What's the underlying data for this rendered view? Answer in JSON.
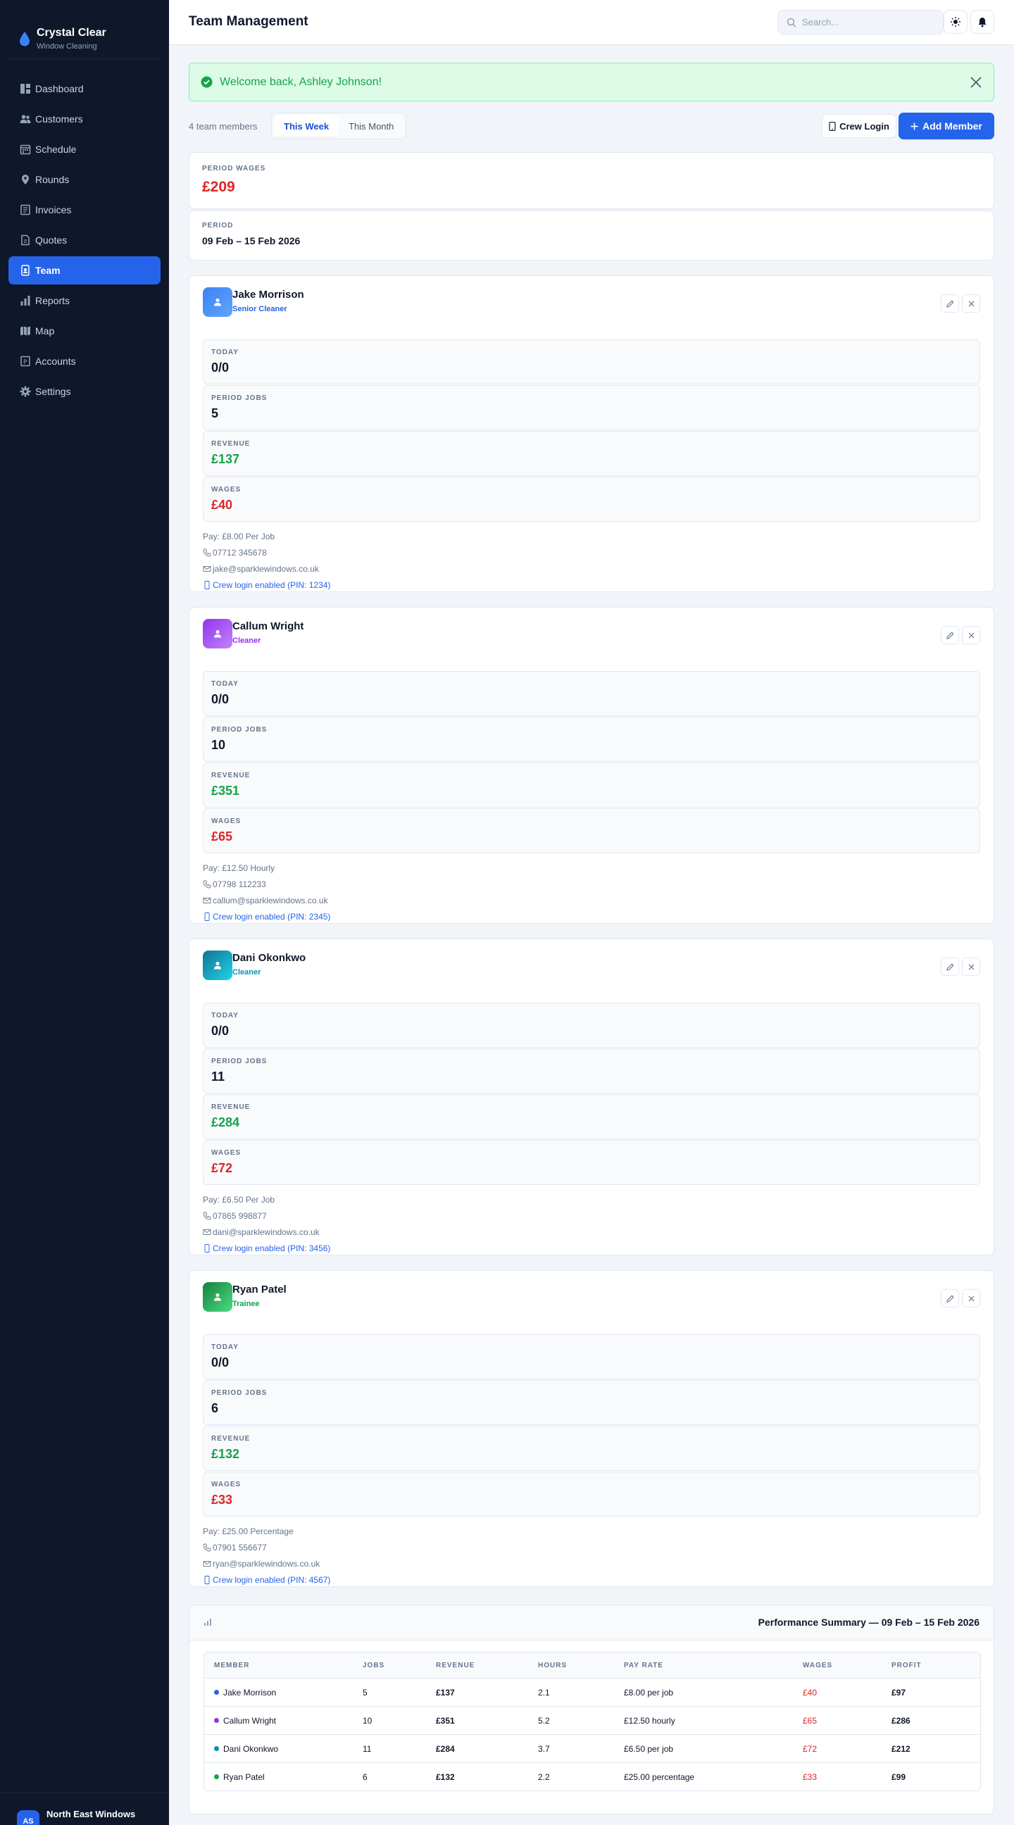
{
  "brand": {
    "name": "Crystal Clear",
    "subtitle": "Window Cleaning"
  },
  "nav": [
    {
      "label": "Dashboard",
      "icon": "dashboard-icon"
    },
    {
      "label": "Customers",
      "icon": "users-icon"
    },
    {
      "label": "Schedule",
      "icon": "calendar-icon"
    },
    {
      "label": "Rounds",
      "icon": "map-pin-icon"
    },
    {
      "label": "Invoices",
      "icon": "invoice-icon"
    },
    {
      "label": "Quotes",
      "icon": "quote-icon"
    },
    {
      "label": "Team",
      "icon": "id-badge-icon",
      "active": true
    },
    {
      "label": "Reports",
      "icon": "bar-chart-icon"
    },
    {
      "label": "Map",
      "icon": "map-icon"
    },
    {
      "label": "Accounts",
      "icon": "ledger-icon"
    },
    {
      "label": "Settings",
      "icon": "gear-icon"
    }
  ],
  "footer": {
    "initials": "AS",
    "business": "North East Windows"
  },
  "header": {
    "title": "Team Management",
    "search_placeholder": "Search..."
  },
  "alert": {
    "message": "Welcome back, Ashley Johnson!"
  },
  "toolbar": {
    "members_count": "4 team members",
    "period_tabs": [
      {
        "label": "This Week",
        "active": true
      },
      {
        "label": "This Month"
      }
    ],
    "crew_login_label": "Crew Login",
    "add_member_label": "Add Member"
  },
  "summary_cards": {
    "wages_label": "PERIOD WAGES",
    "wages_value": "£209",
    "period_label": "PERIOD",
    "period_value": "09 Feb – 15 Feb 2026"
  },
  "stat_labels": {
    "today": "TODAY",
    "jobs": "PERIOD JOBS",
    "revenue": "REVENUE",
    "wages": "WAGES"
  },
  "members": [
    {
      "name": "Jake Morrison",
      "role": "Senior Cleaner",
      "role_color": "#2563eb",
      "avatar_gradient": [
        "#3b82f6",
        "#60a5fa"
      ],
      "today": "0/0",
      "jobs": "5",
      "revenue": "£137",
      "wages": "£40",
      "pay": "Pay: £8.00 Per Job",
      "phone": "07712 345678",
      "email": "jake@sparklewindows.co.uk",
      "crew": "Crew login enabled (PIN: 1234)"
    },
    {
      "name": "Callum Wright",
      "role": "Cleaner",
      "role_color": "#9333ea",
      "avatar_gradient": [
        "#9333ea",
        "#c084fc"
      ],
      "today": "0/0",
      "jobs": "10",
      "revenue": "£351",
      "wages": "£65",
      "pay": "Pay: £12.50 Hourly",
      "phone": "07798 112233",
      "email": "callum@sparklewindows.co.uk",
      "crew": "Crew login enabled (PIN: 2345)"
    },
    {
      "name": "Dani Okonkwo",
      "role": "Cleaner",
      "role_color": "#0891b2",
      "avatar_gradient": [
        "#0e7490",
        "#22d3ee"
      ],
      "today": "0/0",
      "jobs": "11",
      "revenue": "£284",
      "wages": "£72",
      "pay": "Pay: £6.50 Per Job",
      "phone": "07865 998877",
      "email": "dani@sparklewindows.co.uk",
      "crew": "Crew login enabled (PIN: 3456)"
    },
    {
      "name": "Ryan Patel",
      "role": "Trainee",
      "role_color": "#16a34a",
      "avatar_gradient": [
        "#15803d",
        "#4ade80"
      ],
      "today": "0/0",
      "jobs": "6",
      "revenue": "£132",
      "wages": "£33",
      "pay": "Pay: £25.00 Percentage",
      "phone": "07901 556677",
      "email": "ryan@sparklewindows.co.uk",
      "crew": "Crew login enabled (PIN: 4567)"
    }
  ],
  "performance": {
    "title": "Performance Summary — 09 Feb – 15 Feb 2026",
    "columns": [
      "MEMBER",
      "JOBS",
      "REVENUE",
      "HOURS",
      "PAY RATE",
      "WAGES",
      "PROFIT"
    ],
    "rows": [
      {
        "member": "Jake Morrison",
        "dot": "#2563eb",
        "jobs": "5",
        "revenue": "£137",
        "hours": "2.1",
        "pay_rate": "£8.00 per job",
        "wages": "£40",
        "profit": "£97"
      },
      {
        "member": "Callum Wright",
        "dot": "#9333ea",
        "jobs": "10",
        "revenue": "£351",
        "hours": "5.2",
        "pay_rate": "£12.50 hourly",
        "wages": "£65",
        "profit": "£286"
      },
      {
        "member": "Dani Okonkwo",
        "dot": "#0891b2",
        "jobs": "11",
        "revenue": "£284",
        "hours": "3.7",
        "pay_rate": "£6.50 per job",
        "wages": "£72",
        "profit": "£212"
      },
      {
        "member": "Ryan Patel",
        "dot": "#16a34a",
        "jobs": "6",
        "revenue": "£132",
        "hours": "2.2",
        "pay_rate": "£25.00 percentage",
        "wages": "£33",
        "profit": "£99"
      }
    ]
  },
  "colors": {
    "accent": "#2563eb",
    "revenue": "#16a34a",
    "wages": "#dc2626",
    "sidebar": "#0f172a"
  }
}
